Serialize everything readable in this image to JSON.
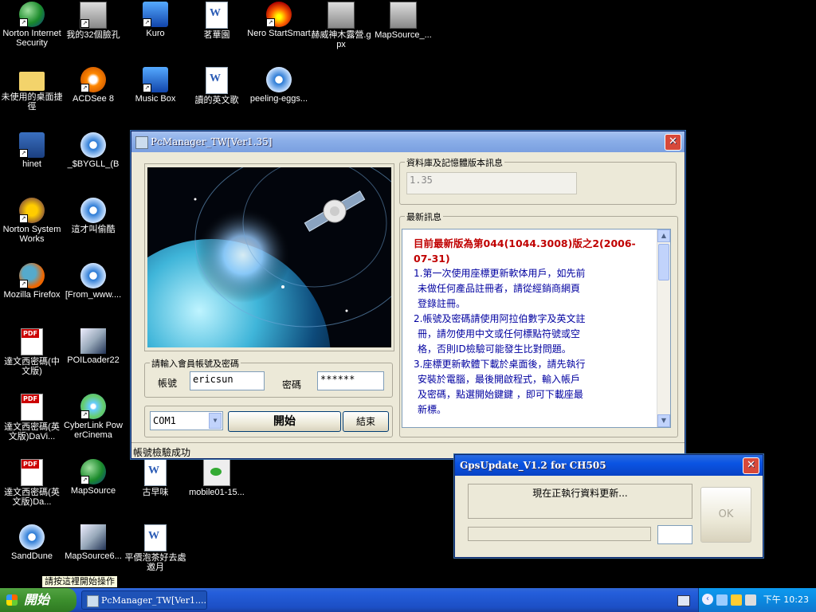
{
  "desktop": {
    "icons": [
      {
        "label": "Norton Internet Security"
      },
      {
        "label": "我的32個臉孔"
      },
      {
        "label": "Kuro"
      },
      {
        "label": "茗華園"
      },
      {
        "label": "Nero StartSmart"
      },
      {
        "label": "赫威神木露營.gpx"
      },
      {
        "label": "MapSource_..."
      },
      {
        "label": "未使用的桌面捷徑"
      },
      {
        "label": "ACDSee 8"
      },
      {
        "label": "Music Box"
      },
      {
        "label": "讀的英文歌"
      },
      {
        "label": "peeling-eggs..."
      },
      {
        "label": "hinet"
      },
      {
        "label": "_$BYGLL_(B"
      },
      {
        "label": "Norton SystemWorks"
      },
      {
        "label": "這才叫偷酷"
      },
      {
        "label": "Mozilla Firefox"
      },
      {
        "label": "[From_www...."
      },
      {
        "label": "達文西密碼(中文版)"
      },
      {
        "label": "POILoader22"
      },
      {
        "label": "達文西密碼(英文版)DaVi..."
      },
      {
        "label": "CyberLink PowerCinema"
      },
      {
        "label": "達文西密碼(英文版)Da..."
      },
      {
        "label": "MapSource"
      },
      {
        "label": "古早味"
      },
      {
        "label": "mobile01-15..."
      },
      {
        "label": "SandDune"
      },
      {
        "label": "MapSource6..."
      },
      {
        "label": "平價泡茶好去處邀月"
      }
    ]
  },
  "pcmanager": {
    "title": "PcManager_TW[Ver1.35]",
    "close_label": "✕",
    "db_group_label": "資料庫及記憶體版本訊息",
    "db_version": "1.35",
    "news_group_label": "最新訊息",
    "news": {
      "headline": "目前最新版為第044(1044.3008)版之2(2006-07-31)",
      "items": [
        "1.第一次使用座標更新軟体用戶，如先前",
        "未做任何產品註冊者，請從經銷商網頁",
        "登錄註冊。",
        "2.帳號及密碼請使用阿拉伯數字及英文註",
        "冊，請勿使用中文或任何標點符號或空",
        "格，否則ID檢驗可能發生比對問題。",
        "3.座標更新軟體下載於桌面後，請先執行",
        "安裝於電腦，最後開啟程式，輸入帳戶",
        "及密碼，點選開始鍵鍵 ，即可下載座最",
        "新標。"
      ]
    },
    "login_group_label": "請輸入會員帳號及密碼",
    "account_label": "帳號",
    "account_value": "ericsun",
    "password_label": "密碼",
    "password_value": "******",
    "port_selected": "COM1",
    "start_label": "開始",
    "end_label": "結束",
    "status_text": "帳號檢驗成功"
  },
  "gpsupdate": {
    "title": "GpsUpdate_V1.2 for CH505",
    "close_label": "✕",
    "message": "現在正執行資料更新...",
    "ok_label": "OK",
    "progress": 0
  },
  "taskbar": {
    "start_label": "開始",
    "task_label": "PcManager_TW[Ver1....",
    "clock": "下午 10:23",
    "tooltip": "請按這裡開始操作"
  },
  "colors": {
    "taskbar_blue": "#245edb",
    "start_green": "#3c8f2d",
    "headline_red": "#c00000",
    "news_blue": "#0000a0",
    "window_face": "#ece9d8"
  }
}
